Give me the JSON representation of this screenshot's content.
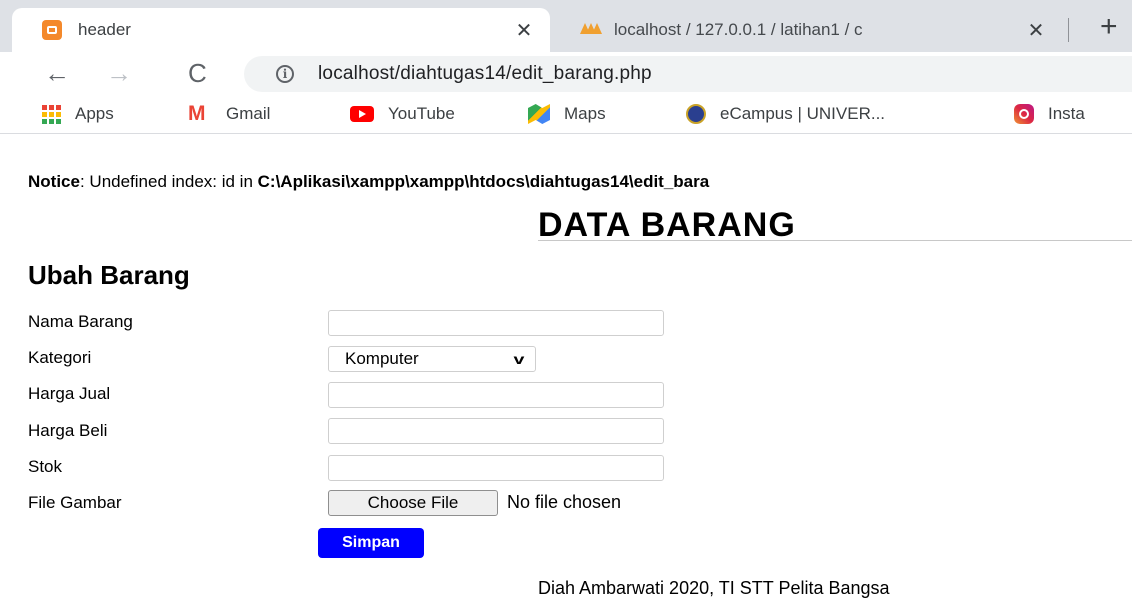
{
  "browser": {
    "tabs": [
      {
        "title": "header",
        "icon": "xampp-icon",
        "active": true
      },
      {
        "title": "localhost / 127.0.0.1 / latihan1 / c",
        "icon": "phpmyadmin-icon",
        "active": false
      }
    ],
    "close_glyph": "✕",
    "new_tab_glyph": "+",
    "url": "localhost/diahtugas14/edit_barang.php",
    "bookmarks": [
      {
        "label": "Apps",
        "icon": "apps-grid-icon"
      },
      {
        "label": "Gmail",
        "icon": "gmail-icon"
      },
      {
        "label": "YouTube",
        "icon": "youtube-icon"
      },
      {
        "label": "Maps",
        "icon": "maps-icon"
      },
      {
        "label": "eCampus | UNIVER...",
        "icon": "ecampus-icon"
      },
      {
        "label": "Insta",
        "icon": "instagram-icon"
      }
    ]
  },
  "page": {
    "notice_label": "Notice",
    "notice_text": ": Undefined index: id in ",
    "notice_path": "C:\\Aplikasi\\xampp\\xampp\\htdocs\\diahtugas14\\edit_bara",
    "heading": "DATA BARANG",
    "form_title": "Ubah Barang",
    "fields": {
      "nama_barang": {
        "label": "Nama Barang",
        "value": ""
      },
      "kategori": {
        "label": "Kategori",
        "selected": "Komputer"
      },
      "harga_jual": {
        "label": "Harga Jual",
        "value": ""
      },
      "harga_beli": {
        "label": "Harga Beli",
        "value": ""
      },
      "stok": {
        "label": "Stok",
        "value": ""
      },
      "file_gambar": {
        "label": "File Gambar",
        "button": "Choose File",
        "status": "No file chosen"
      }
    },
    "submit_label": "Simpan",
    "footer": "Diah Ambarwati 2020, TI STT Pelita Bangsa"
  },
  "colors": {
    "submit_bg": "#0000ff",
    "tab_strip": "#dee1e6"
  }
}
